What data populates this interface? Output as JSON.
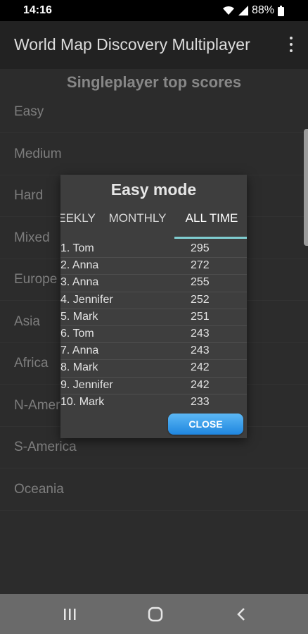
{
  "status_bar": {
    "time": "14:16",
    "battery": "88%",
    "icons": [
      "wifi-icon",
      "signal-icon",
      "battery-icon"
    ]
  },
  "app_bar": {
    "title": "World Map Discovery Multiplayer",
    "menu_icon": "overflow-menu-icon"
  },
  "page": {
    "section_title": "Singleplayer top scores",
    "modes": [
      "Easy",
      "Medium",
      "Hard",
      "Mixed",
      "Europe",
      "Asia",
      "Africa",
      "N-America",
      "S-America",
      "Oceania"
    ]
  },
  "dialog": {
    "title": "Easy mode",
    "tabs": [
      "WEEKLY",
      "MONTHLY",
      "ALL TIME"
    ],
    "selected_tab": "ALL TIME",
    "scores": [
      {
        "name": "1. Tom",
        "score": "295"
      },
      {
        "name": "2. Anna",
        "score": "272"
      },
      {
        "name": "3. Anna",
        "score": "255"
      },
      {
        "name": "4. Jennifer",
        "score": "252"
      },
      {
        "name": "5. Mark",
        "score": "251"
      },
      {
        "name": "6. Tom",
        "score": "243"
      },
      {
        "name": "7. Anna",
        "score": "243"
      },
      {
        "name": "8. Mark",
        "score": "242"
      },
      {
        "name": "9. Jennifer",
        "score": "242"
      },
      {
        "name": "10. Mark",
        "score": "233"
      }
    ],
    "close_label": "CLOSE"
  },
  "nav_bar": {
    "icons": [
      "recent-apps-icon",
      "home-icon",
      "back-icon"
    ]
  },
  "colors": {
    "accent_tab": "#7fcdd0",
    "close_button": "#2a90e6",
    "background": "#333333"
  }
}
